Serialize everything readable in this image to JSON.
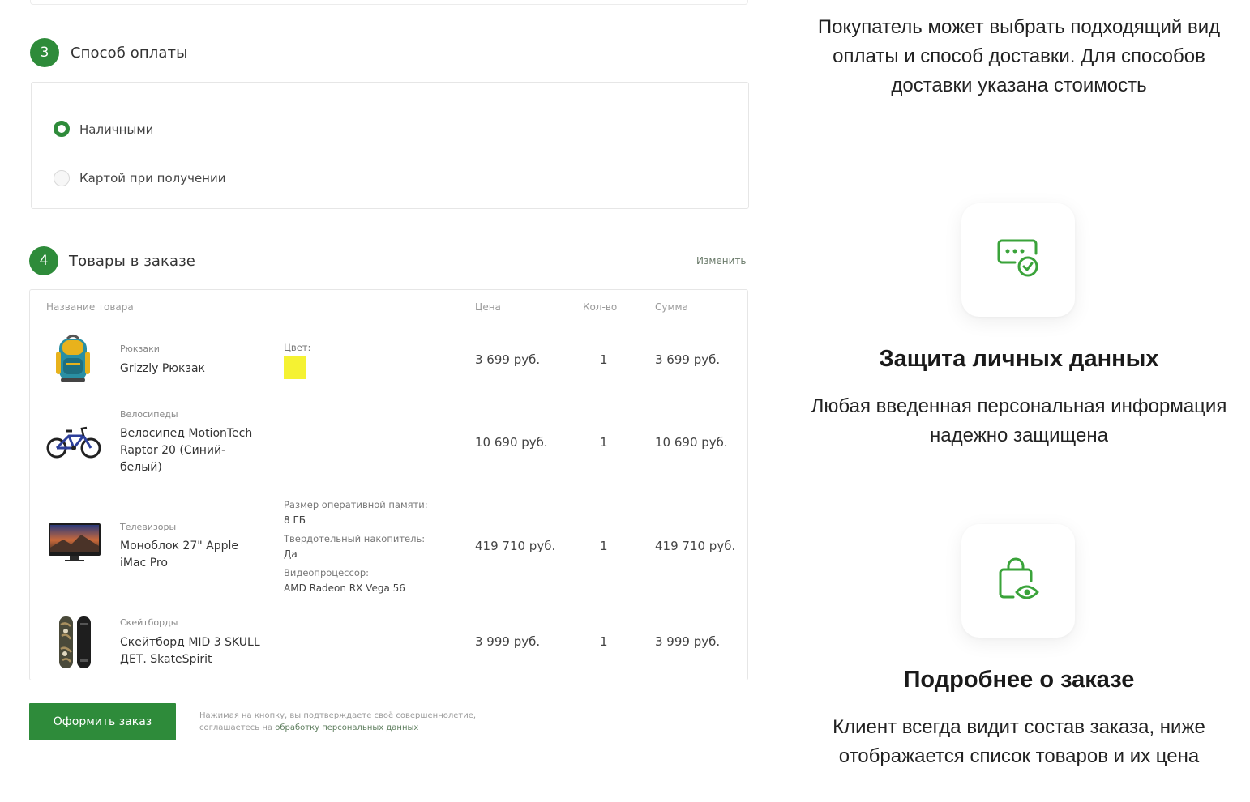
{
  "payment": {
    "step": "3",
    "title": "Способ оплаты",
    "options": [
      {
        "label": "Наличными",
        "selected": true
      },
      {
        "label": "Картой при получении",
        "selected": false
      }
    ]
  },
  "goods": {
    "step": "4",
    "title": "Товары в заказе",
    "change_link": "Изменить",
    "columns": {
      "name": "Название товара",
      "price": "Цена",
      "qty": "Кол-во",
      "sum": "Сумма"
    },
    "items": [
      {
        "category": "Рюкзаки",
        "name": "Grizzly Рюкзак",
        "color_label": "Цвет:",
        "color_hex": "#f5f232",
        "price": "3 699 руб.",
        "qty": "1",
        "sum": "3 699 руб."
      },
      {
        "category": "Велосипеды",
        "name": "Велосипед MotionTech Raptor 20 (Синий-белый)",
        "price": "10 690 руб.",
        "qty": "1",
        "sum": "10 690 руб."
      },
      {
        "category": "Телевизоры",
        "name": "Моноблок 27\" Apple iMac Pro",
        "props": [
          {
            "label": "Размер оперативной памяти:",
            "value": "8 ГБ"
          },
          {
            "label": "Твердотельный накопитель:",
            "value": "Да"
          },
          {
            "label": "Видеопроцессор:",
            "value": "AMD Radeon RX Vega 56"
          }
        ],
        "price": "419 710 руб.",
        "qty": "1",
        "sum": "419 710 руб."
      },
      {
        "category": "Скейтборды",
        "name": "Скейтборд MID 3 SKULL ДЕТ. SkateSpirit",
        "price": "3 999 руб.",
        "qty": "1",
        "sum": "3 999 руб."
      }
    ]
  },
  "order_button": "Оформить заказ",
  "disclaimer": {
    "line1": "Нажимая на кнопку, вы подтверждаете своё совершеннолетие,",
    "line2_prefix": "соглашаетесь на ",
    "line2_link": "обработку персональных данных"
  },
  "features": {
    "intro": "Покупатель может выбрать подходящий вид оплаты и способ доставки. Для способов доставки указана стоимость",
    "privacy_title": "Защита личных данных",
    "privacy_text": "Любая введенная персональная информация надежно защищена",
    "details_title": "Подробнее о заказе",
    "details_text": "Клиент всегда видит состав заказа, ниже отображается список товаров и их цена"
  },
  "colors": {
    "accent": "#2e8b3a",
    "icon": "#3aa33a"
  },
  "icons": [
    "password-check-icon",
    "bag-eye-icon",
    "backpack-image",
    "bicycle-image",
    "imac-image",
    "skateboard-image"
  ]
}
